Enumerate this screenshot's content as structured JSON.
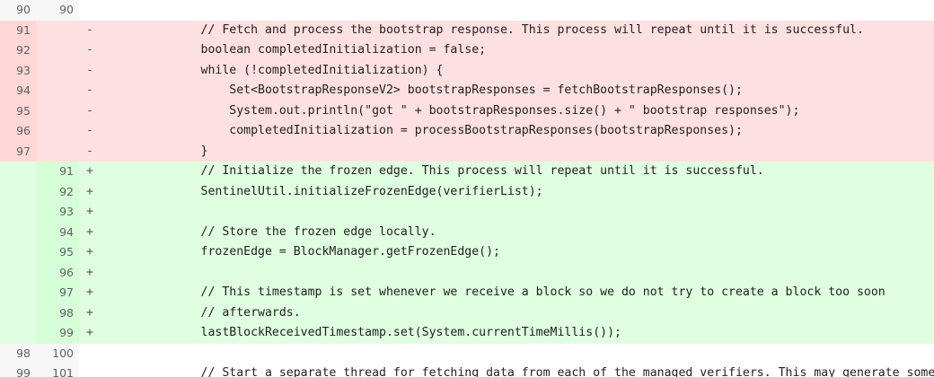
{
  "lines": [
    {
      "type": "ctx",
      "old": "90",
      "new": "90",
      "sign": "",
      "text": ""
    },
    {
      "type": "del",
      "old": "91",
      "new": "",
      "sign": "-",
      "text": "        // Fetch and process the bootstrap response. This process will repeat until it is successful."
    },
    {
      "type": "del",
      "old": "92",
      "new": "",
      "sign": "-",
      "text": "        boolean completedInitialization = false;"
    },
    {
      "type": "del",
      "old": "93",
      "new": "",
      "sign": "-",
      "text": "        while (!completedInitialization) {"
    },
    {
      "type": "del",
      "old": "94",
      "new": "",
      "sign": "-",
      "text": "            Set<BootstrapResponseV2> bootstrapResponses = fetchBootstrapResponses();"
    },
    {
      "type": "del",
      "old": "95",
      "new": "",
      "sign": "-",
      "text": "            System.out.println(\"got \" + bootstrapResponses.size() + \" bootstrap responses\");"
    },
    {
      "type": "del",
      "old": "96",
      "new": "",
      "sign": "-",
      "text": "            completedInitialization = processBootstrapResponses(bootstrapResponses);"
    },
    {
      "type": "del",
      "old": "97",
      "new": "",
      "sign": "-",
      "text": "        }"
    },
    {
      "type": "add",
      "old": "",
      "new": "91",
      "sign": "+",
      "text": "        // Initialize the frozen edge. This process will repeat until it is successful."
    },
    {
      "type": "add",
      "old": "",
      "new": "92",
      "sign": "+",
      "text": "        SentinelUtil.initializeFrozenEdge(verifierList);"
    },
    {
      "type": "add",
      "old": "",
      "new": "93",
      "sign": "+",
      "text": ""
    },
    {
      "type": "add",
      "old": "",
      "new": "94",
      "sign": "+",
      "text": "        // Store the frozen edge locally."
    },
    {
      "type": "add",
      "old": "",
      "new": "95",
      "sign": "+",
      "text": "        frozenEdge = BlockManager.getFrozenEdge();"
    },
    {
      "type": "add",
      "old": "",
      "new": "96",
      "sign": "+",
      "text": ""
    },
    {
      "type": "add",
      "old": "",
      "new": "97",
      "sign": "+",
      "text": "        // This timestamp is set whenever we receive a block so we do not try to create a block too soon"
    },
    {
      "type": "add",
      "old": "",
      "new": "98",
      "sign": "+",
      "text": "        // afterwards."
    },
    {
      "type": "add",
      "old": "",
      "new": "99",
      "sign": "+",
      "text": "        lastBlockReceivedTimestamp.set(System.currentTimeMillis());"
    },
    {
      "type": "ctx",
      "old": "98",
      "new": "100",
      "sign": "",
      "text": ""
    },
    {
      "type": "ctx",
      "old": "99",
      "new": "101",
      "sign": "",
      "text": "        // Start a separate thread for fetching data from each of the managed verifiers. This may generate some"
    }
  ],
  "colors": {
    "deleted_bg": "#ffe0e0",
    "deleted_highlight": "#ffb3b3",
    "added_bg": "#e0ffe0",
    "added_highlight": "#a6f3a6"
  }
}
